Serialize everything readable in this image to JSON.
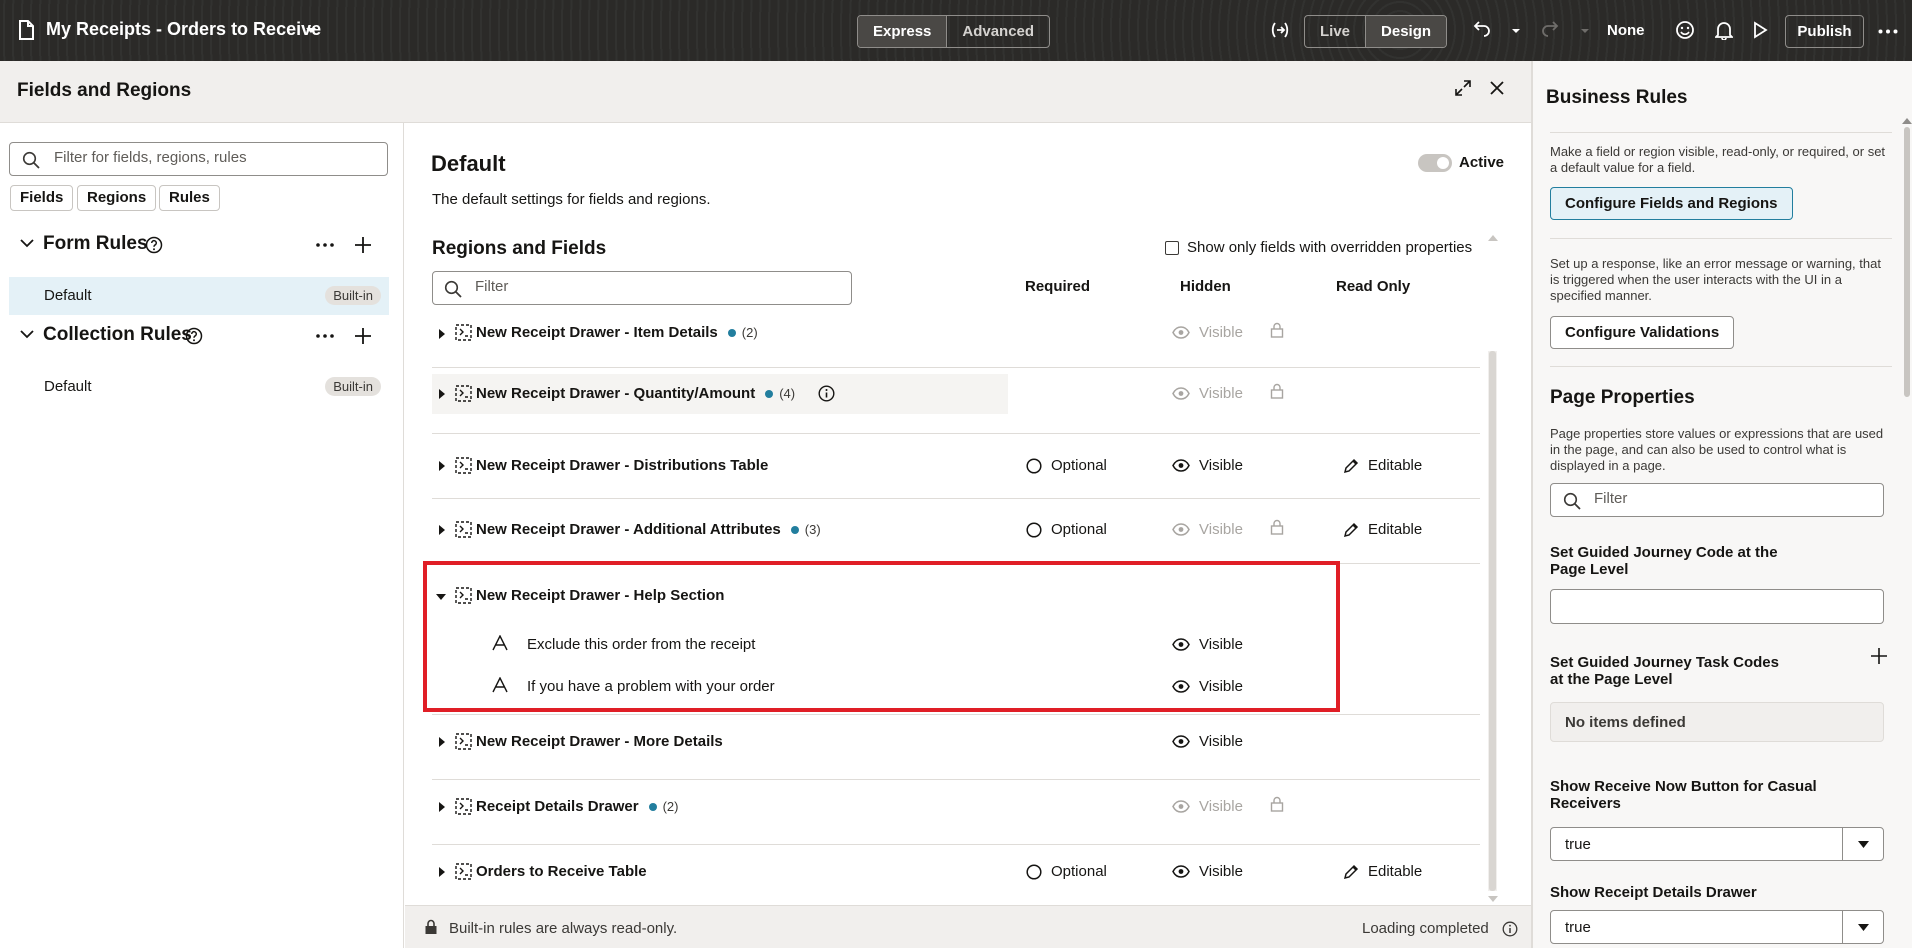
{
  "topbar": {
    "title": "My Receipts - Orders to Receive",
    "mode_express": "Express",
    "mode_advanced": "Advanced",
    "live": "Live",
    "design": "Design",
    "none": "None",
    "publish": "Publish"
  },
  "fields_regions": {
    "title": "Fields and Regions"
  },
  "left": {
    "search_placeholder": "Filter for fields, regions, rules",
    "chips": [
      "Fields",
      "Regions",
      "Rules"
    ],
    "form_rules": "Form Rules",
    "collection_rules": "Collection Rules",
    "form_rule_items": [
      {
        "name": "Default",
        "badge": "Built-in"
      }
    ],
    "collection_rule_items": [
      {
        "name": "Default",
        "badge": "Built-in"
      }
    ]
  },
  "main": {
    "title": "Default",
    "active_label": "Active",
    "description": "The default settings for fields and regions.",
    "section_title": "Regions and Fields",
    "override_label": "Show only fields with overridden properties",
    "filter_placeholder": "Filter",
    "columns": {
      "required": "Required",
      "hidden": "Hidden",
      "read_only": "Read Only"
    },
    "rows": [
      {
        "name": "New Receipt Drawer - Item Details",
        "count": "(2)",
        "hidden": "Visible"
      },
      {
        "name": "New Receipt Drawer - Quantity/Amount",
        "count": "(4)",
        "hidden": "Visible"
      },
      {
        "name": "New Receipt Drawer - Distributions Table",
        "required": "Optional",
        "hidden": "Visible",
        "read_only": "Editable"
      },
      {
        "name": "New Receipt Drawer - Additional Attributes",
        "count": "(3)",
        "required": "Optional",
        "hidden": "Visible",
        "read_only": "Editable"
      },
      {
        "name": "New Receipt Drawer - Help Section"
      },
      {
        "name": "New Receipt Drawer - More Details",
        "hidden": "Visible"
      },
      {
        "name": "Receipt Details Drawer",
        "count": "(2)",
        "hidden": "Visible"
      },
      {
        "name": "Orders to Receive Table",
        "required": "Optional",
        "hidden": "Visible",
        "read_only": "Editable"
      }
    ],
    "help_children": [
      {
        "name": "Exclude this order from the receipt",
        "hidden": "Visible"
      },
      {
        "name": "If you have a problem with your order",
        "hidden": "Visible"
      }
    ],
    "footer_note": "Built-in rules are always read-only.",
    "footer_status": "Loading completed"
  },
  "right": {
    "business_rules_title": "Business Rules",
    "br_text_1": "Make a field or region visible, read-only, or required, or set a default value for a field.",
    "configure_fields_btn": "Configure Fields and Regions",
    "br_text_2": "Set up a response, like an error message or warning, that is triggered when the user interacts with the UI in a specified manner.",
    "configure_validations_btn": "Configure Validations",
    "page_props_title": "Page Properties",
    "pp_text": "Page properties store values or expressions that are used in the page, and can also be used to control what is displayed in a page.",
    "filter_placeholder": "Filter",
    "prop_1_label": "Set Guided Journey Code at the Page Level",
    "prop_2_label": "Set Guided Journey Task Codes at the Page Level",
    "no_items": "No items defined",
    "prop_3_label": "Show Receive Now Button for Casual Receivers",
    "prop_3_value": "true",
    "prop_4_label": "Show Receipt Details Drawer",
    "prop_4_value": "true"
  },
  "colors": {
    "accent": "#227e9e",
    "highlight": "#e01e26",
    "topbar": "#2b2a28"
  }
}
